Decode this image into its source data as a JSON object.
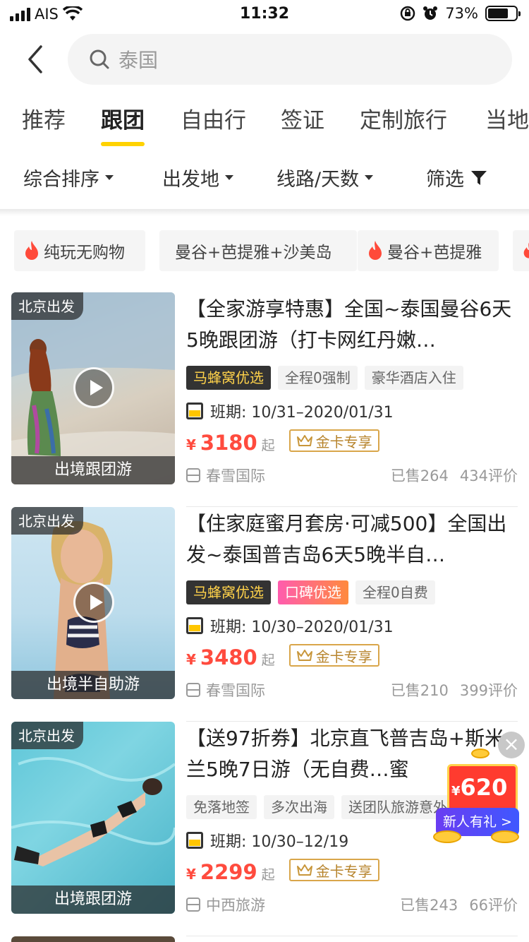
{
  "status_bar": {
    "carrier": "AIS",
    "time": "11:32",
    "battery": "73%",
    "battery_level": 0.73
  },
  "search": {
    "query": "泰国"
  },
  "tabs": [
    {
      "label": "推荐"
    },
    {
      "label": "跟团",
      "active": true
    },
    {
      "label": "自由行"
    },
    {
      "label": "签证"
    },
    {
      "label": "定制旅行"
    },
    {
      "label": "当地"
    }
  ],
  "filters": [
    {
      "label": "综合排序"
    },
    {
      "label": "出发地"
    },
    {
      "label": "线路/天数"
    },
    {
      "label": "筛选"
    }
  ],
  "chips": [
    {
      "label": "纯玩无购物",
      "hot": true
    },
    {
      "label": "曼谷+芭提雅+沙美岛",
      "hot": false
    },
    {
      "label": "曼谷+芭提雅",
      "hot": true
    }
  ],
  "products": [
    {
      "origin": "北京出发",
      "caption": "出境跟团游",
      "title": "【全家游享特惠】全国~泰国曼谷6天5晚跟团游（打卡网红丹嫩…",
      "tags": [
        {
          "text": "马蜂窝优选",
          "style": "mfw"
        },
        {
          "text": "全程0强制",
          "style": "plain"
        },
        {
          "text": "豪华酒店入住",
          "style": "plain"
        }
      ],
      "period": "班期: 10/31–2020/01/31",
      "currency": "¥",
      "price": "3180",
      "price_suffix": "起",
      "gold_label": "金卡专享",
      "agency": "春雪国际",
      "sold": "已售264",
      "reviews": "434评价"
    },
    {
      "origin": "北京出发",
      "caption": "出境半自助游",
      "title": "【住家庭蜜月套房·可减500】全国出发~泰国普吉岛6天5晚半自…",
      "tags": [
        {
          "text": "马蜂窝优选",
          "style": "mfw"
        },
        {
          "text": "口碑优选",
          "style": "kb"
        },
        {
          "text": "全程0自费",
          "style": "plain"
        }
      ],
      "period": "班期: 10/30–2020/01/31",
      "currency": "¥",
      "price": "3480",
      "price_suffix": "起",
      "gold_label": "金卡专享",
      "agency": "春雪国际",
      "sold": "已售210",
      "reviews": "399评价"
    },
    {
      "origin": "北京出发",
      "caption": "出境跟团游",
      "title": "【送97折券】北京直飞普吉岛+斯米兰5晚7日游（无自费…蜜",
      "tags": [
        {
          "text": "免落地签",
          "style": "plain"
        },
        {
          "text": "多次出海",
          "style": "plain"
        },
        {
          "text": "送团队旅游意外险",
          "style": "plain"
        }
      ],
      "period": "班期: 10/30–12/19",
      "currency": "¥",
      "price": "2299",
      "price_suffix": "起",
      "gold_label": "金卡专享",
      "agency": "中西旅游",
      "sold": "已售243",
      "reviews": "66评价"
    }
  ],
  "promo": {
    "currency": "¥",
    "amount": "620",
    "label": "新人有礼 >"
  },
  "colors": {
    "accent": "#ffd200",
    "price": "#ff4b3e",
    "gold": "#b7842c"
  }
}
